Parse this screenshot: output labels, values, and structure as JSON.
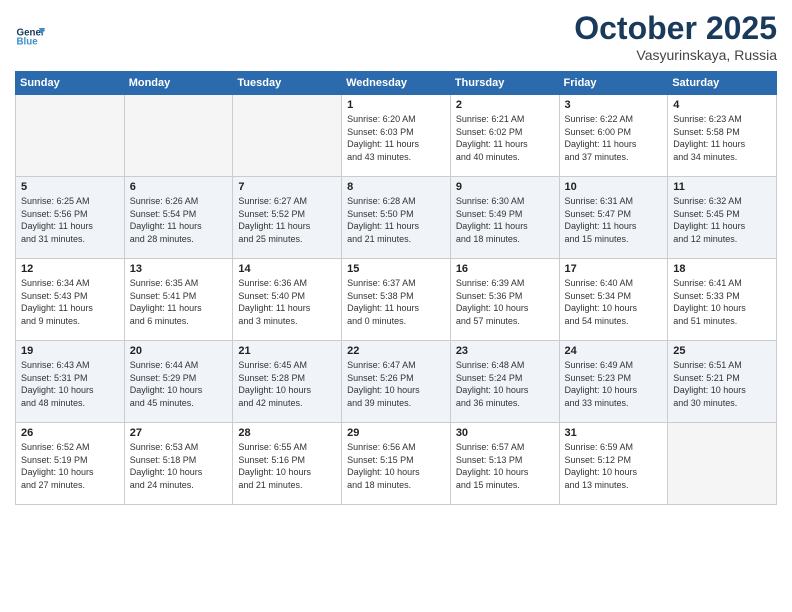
{
  "header": {
    "logo_line1": "General",
    "logo_line2": "Blue",
    "month": "October 2025",
    "location": "Vasyurinskaya, Russia"
  },
  "weekdays": [
    "Sunday",
    "Monday",
    "Tuesday",
    "Wednesday",
    "Thursday",
    "Friday",
    "Saturday"
  ],
  "weeks": [
    [
      {
        "day": "",
        "info": ""
      },
      {
        "day": "",
        "info": ""
      },
      {
        "day": "",
        "info": ""
      },
      {
        "day": "1",
        "info": "Sunrise: 6:20 AM\nSunset: 6:03 PM\nDaylight: 11 hours\nand 43 minutes."
      },
      {
        "day": "2",
        "info": "Sunrise: 6:21 AM\nSunset: 6:02 PM\nDaylight: 11 hours\nand 40 minutes."
      },
      {
        "day": "3",
        "info": "Sunrise: 6:22 AM\nSunset: 6:00 PM\nDaylight: 11 hours\nand 37 minutes."
      },
      {
        "day": "4",
        "info": "Sunrise: 6:23 AM\nSunset: 5:58 PM\nDaylight: 11 hours\nand 34 minutes."
      }
    ],
    [
      {
        "day": "5",
        "info": "Sunrise: 6:25 AM\nSunset: 5:56 PM\nDaylight: 11 hours\nand 31 minutes."
      },
      {
        "day": "6",
        "info": "Sunrise: 6:26 AM\nSunset: 5:54 PM\nDaylight: 11 hours\nand 28 minutes."
      },
      {
        "day": "7",
        "info": "Sunrise: 6:27 AM\nSunset: 5:52 PM\nDaylight: 11 hours\nand 25 minutes."
      },
      {
        "day": "8",
        "info": "Sunrise: 6:28 AM\nSunset: 5:50 PM\nDaylight: 11 hours\nand 21 minutes."
      },
      {
        "day": "9",
        "info": "Sunrise: 6:30 AM\nSunset: 5:49 PM\nDaylight: 11 hours\nand 18 minutes."
      },
      {
        "day": "10",
        "info": "Sunrise: 6:31 AM\nSunset: 5:47 PM\nDaylight: 11 hours\nand 15 minutes."
      },
      {
        "day": "11",
        "info": "Sunrise: 6:32 AM\nSunset: 5:45 PM\nDaylight: 11 hours\nand 12 minutes."
      }
    ],
    [
      {
        "day": "12",
        "info": "Sunrise: 6:34 AM\nSunset: 5:43 PM\nDaylight: 11 hours\nand 9 minutes."
      },
      {
        "day": "13",
        "info": "Sunrise: 6:35 AM\nSunset: 5:41 PM\nDaylight: 11 hours\nand 6 minutes."
      },
      {
        "day": "14",
        "info": "Sunrise: 6:36 AM\nSunset: 5:40 PM\nDaylight: 11 hours\nand 3 minutes."
      },
      {
        "day": "15",
        "info": "Sunrise: 6:37 AM\nSunset: 5:38 PM\nDaylight: 11 hours\nand 0 minutes."
      },
      {
        "day": "16",
        "info": "Sunrise: 6:39 AM\nSunset: 5:36 PM\nDaylight: 10 hours\nand 57 minutes."
      },
      {
        "day": "17",
        "info": "Sunrise: 6:40 AM\nSunset: 5:34 PM\nDaylight: 10 hours\nand 54 minutes."
      },
      {
        "day": "18",
        "info": "Sunrise: 6:41 AM\nSunset: 5:33 PM\nDaylight: 10 hours\nand 51 minutes."
      }
    ],
    [
      {
        "day": "19",
        "info": "Sunrise: 6:43 AM\nSunset: 5:31 PM\nDaylight: 10 hours\nand 48 minutes."
      },
      {
        "day": "20",
        "info": "Sunrise: 6:44 AM\nSunset: 5:29 PM\nDaylight: 10 hours\nand 45 minutes."
      },
      {
        "day": "21",
        "info": "Sunrise: 6:45 AM\nSunset: 5:28 PM\nDaylight: 10 hours\nand 42 minutes."
      },
      {
        "day": "22",
        "info": "Sunrise: 6:47 AM\nSunset: 5:26 PM\nDaylight: 10 hours\nand 39 minutes."
      },
      {
        "day": "23",
        "info": "Sunrise: 6:48 AM\nSunset: 5:24 PM\nDaylight: 10 hours\nand 36 minutes."
      },
      {
        "day": "24",
        "info": "Sunrise: 6:49 AM\nSunset: 5:23 PM\nDaylight: 10 hours\nand 33 minutes."
      },
      {
        "day": "25",
        "info": "Sunrise: 6:51 AM\nSunset: 5:21 PM\nDaylight: 10 hours\nand 30 minutes."
      }
    ],
    [
      {
        "day": "26",
        "info": "Sunrise: 6:52 AM\nSunset: 5:19 PM\nDaylight: 10 hours\nand 27 minutes."
      },
      {
        "day": "27",
        "info": "Sunrise: 6:53 AM\nSunset: 5:18 PM\nDaylight: 10 hours\nand 24 minutes."
      },
      {
        "day": "28",
        "info": "Sunrise: 6:55 AM\nSunset: 5:16 PM\nDaylight: 10 hours\nand 21 minutes."
      },
      {
        "day": "29",
        "info": "Sunrise: 6:56 AM\nSunset: 5:15 PM\nDaylight: 10 hours\nand 18 minutes."
      },
      {
        "day": "30",
        "info": "Sunrise: 6:57 AM\nSunset: 5:13 PM\nDaylight: 10 hours\nand 15 minutes."
      },
      {
        "day": "31",
        "info": "Sunrise: 6:59 AM\nSunset: 5:12 PM\nDaylight: 10 hours\nand 13 minutes."
      },
      {
        "day": "",
        "info": ""
      }
    ]
  ]
}
